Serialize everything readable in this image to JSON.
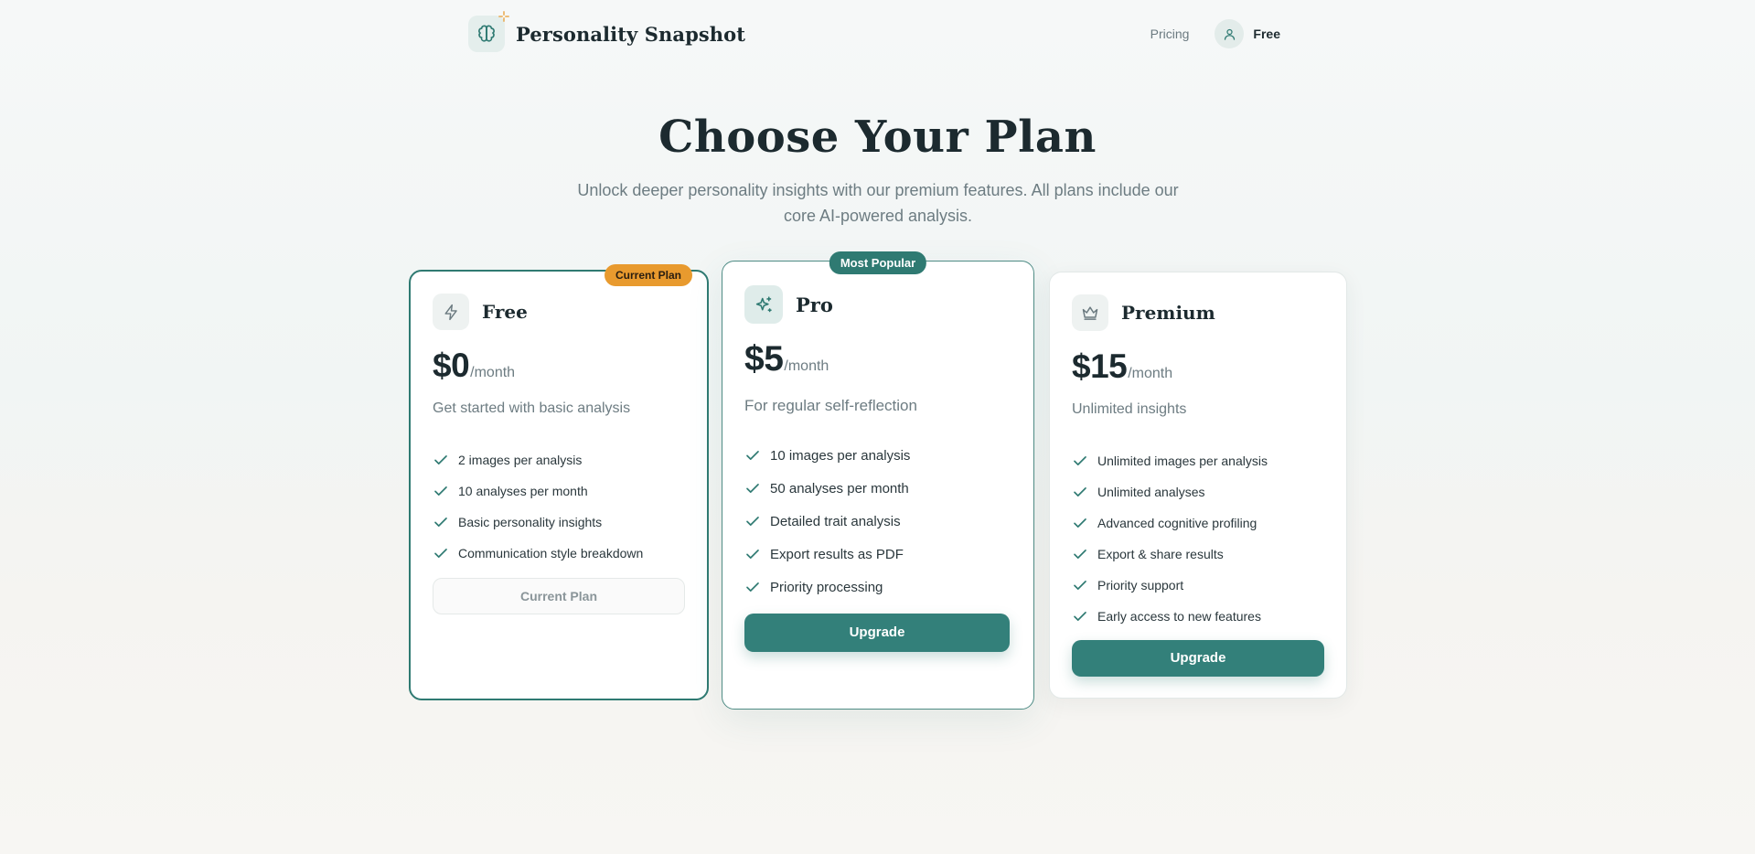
{
  "header": {
    "brand_name": "Personality Snapshot",
    "nav_pricing": "Pricing",
    "account_label": "Free"
  },
  "hero": {
    "title": "Choose Your Plan",
    "subtitle": "Unlock deeper personality insights with our premium features. All plans include our core AI-powered analysis."
  },
  "colors": {
    "accent": "#2f7a72",
    "badge_current": "#e89a2e",
    "text_dark": "#1c2a2f",
    "text_muted": "#6d7c82"
  },
  "plans": [
    {
      "id": "free",
      "name": "Free",
      "icon": "lightning-icon",
      "badge": "Current Plan",
      "price": "$0",
      "period": "/month",
      "description": "Get started with basic analysis",
      "features": [
        "2 images per analysis",
        "10 analyses per month",
        "Basic personality insights",
        "Communication style breakdown"
      ],
      "button_label": "Current Plan"
    },
    {
      "id": "pro",
      "name": "Pro",
      "icon": "sparkles-icon",
      "badge": "Most Popular",
      "price": "$5",
      "period": "/month",
      "description": "For regular self-reflection",
      "features": [
        "10 images per analysis",
        "50 analyses per month",
        "Detailed trait analysis",
        "Export results as PDF",
        "Priority processing"
      ],
      "button_label": "Upgrade"
    },
    {
      "id": "premium",
      "name": "Premium",
      "icon": "crown-icon",
      "price": "$15",
      "period": "/month",
      "description": "Unlimited insights",
      "features": [
        "Unlimited images per analysis",
        "Unlimited analyses",
        "Advanced cognitive profiling",
        "Export & share results",
        "Priority support",
        "Early access to new features"
      ],
      "button_label": "Upgrade"
    }
  ]
}
